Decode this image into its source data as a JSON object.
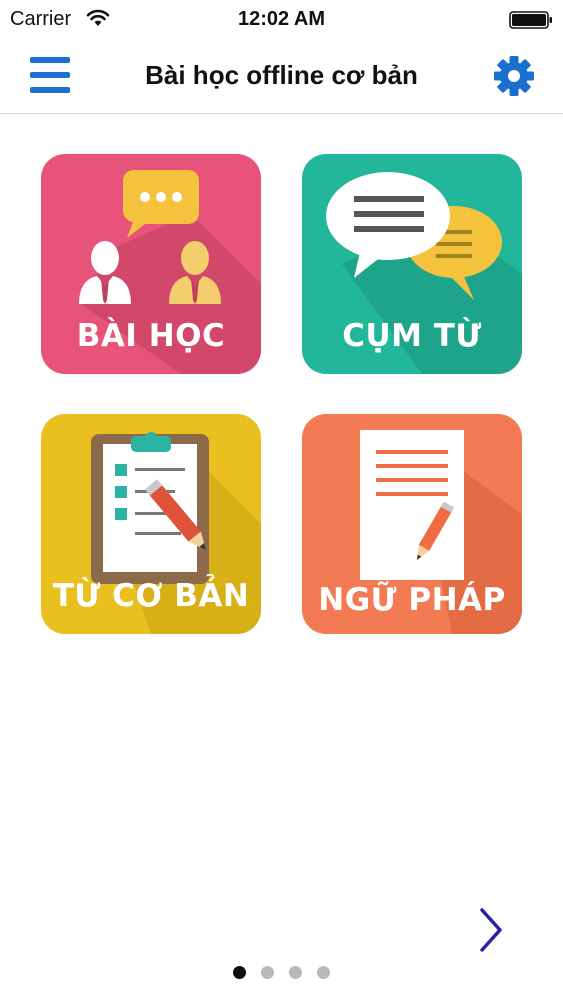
{
  "status_bar": {
    "carrier": "Carrier",
    "time": "12:02 AM"
  },
  "nav": {
    "title": "Bài học offline cơ bản",
    "menu_icon": "hamburger-menu-icon",
    "settings_icon": "gear-icon",
    "accent_color": "#1a6fcf"
  },
  "tiles": [
    {
      "label": "BÀI HỌC",
      "icon": "conversation-people-icon",
      "color": "#e8537a"
    },
    {
      "label": "CỤM TỪ",
      "icon": "speech-bubbles-icon",
      "color": "#22b79a"
    },
    {
      "label": "TỪ CƠ BẢN",
      "icon": "clipboard-checklist-icon",
      "color": "#e9c01f"
    },
    {
      "label": "NGỮ PHÁP",
      "icon": "document-pencil-icon",
      "color": "#f27b53"
    }
  ],
  "pager": {
    "page_count": 4,
    "current_page": 1,
    "next_icon": "chevron-right-icon"
  }
}
